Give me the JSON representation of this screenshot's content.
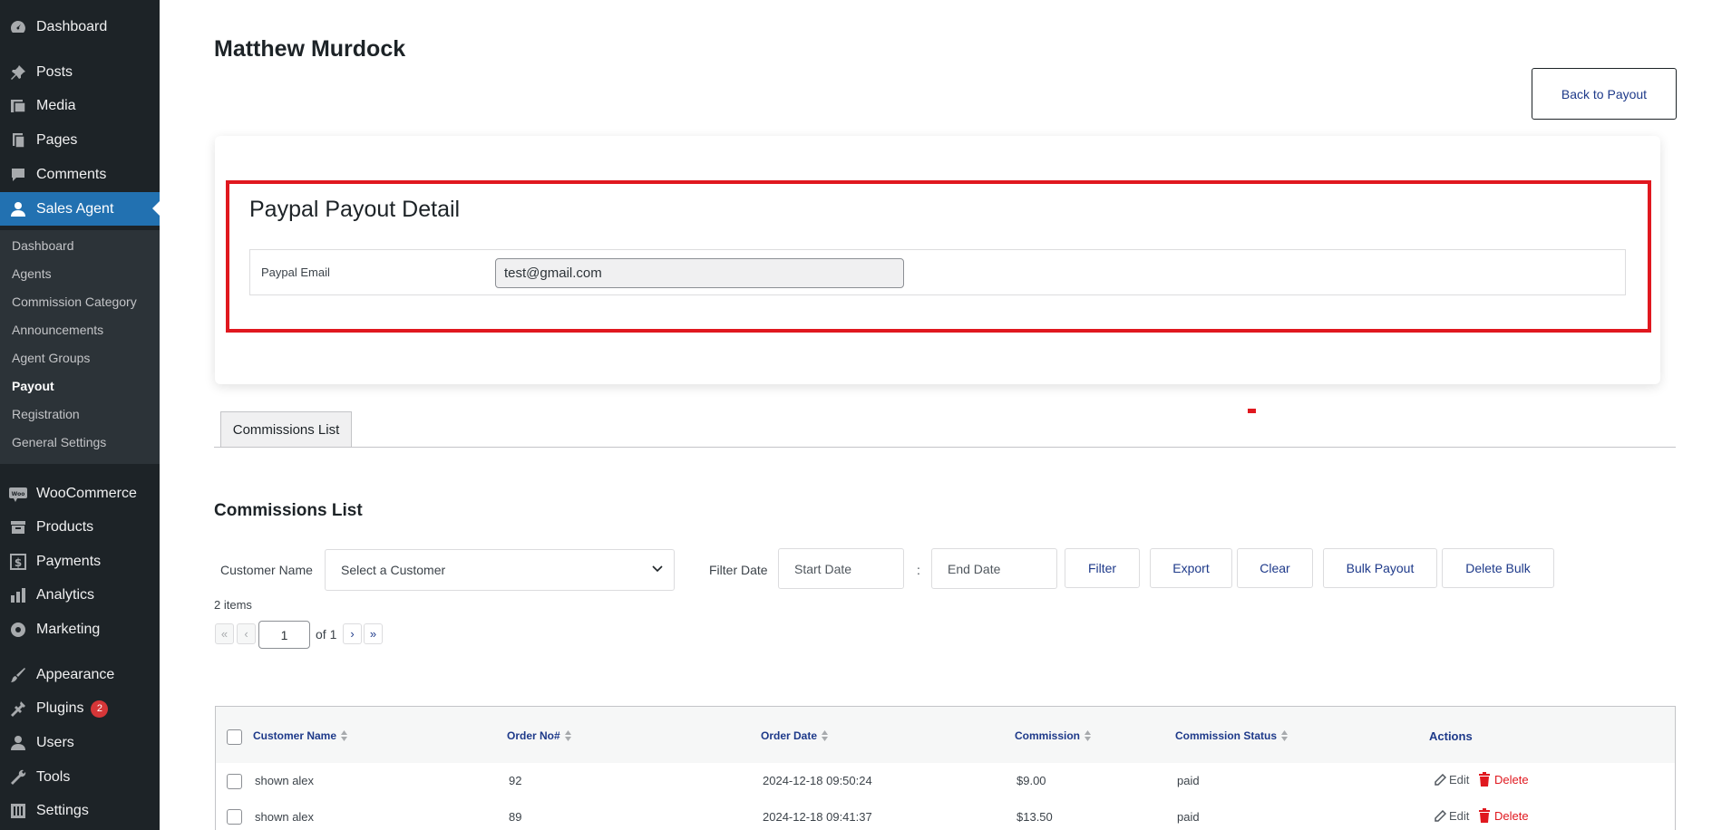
{
  "sidebar": {
    "menu": [
      {
        "label": "Dashboard",
        "icon": "dashboard-icon"
      },
      {
        "label": "Posts",
        "icon": "pin-icon"
      },
      {
        "label": "Media",
        "icon": "media-icon"
      },
      {
        "label": "Pages",
        "icon": "pages-icon"
      },
      {
        "label": "Comments",
        "icon": "comment-icon"
      },
      {
        "label": "Sales Agent",
        "icon": "user-icon"
      },
      {
        "label": "WooCommerce",
        "icon": "woo-icon"
      },
      {
        "label": "Products",
        "icon": "archive-icon"
      },
      {
        "label": "Payments",
        "icon": "dollar-icon"
      },
      {
        "label": "Analytics",
        "icon": "bar-chart-icon"
      },
      {
        "label": "Marketing",
        "icon": "megaphone-icon"
      },
      {
        "label": "Appearance",
        "icon": "brush-icon"
      },
      {
        "label": "Plugins",
        "icon": "plugin-icon",
        "badge": "2"
      },
      {
        "label": "Users",
        "icon": "users-icon"
      },
      {
        "label": "Tools",
        "icon": "wrench-icon"
      },
      {
        "label": "Settings",
        "icon": "settings-icon"
      }
    ],
    "submenu": [
      "Dashboard",
      "Agents",
      "Commission Category",
      "Announcements",
      "Agent Groups",
      "Payout",
      "Registration",
      "General Settings"
    ]
  },
  "page": {
    "title": "Matthew Murdock",
    "back_button": "Back to Payout"
  },
  "paypal": {
    "title": "Paypal Payout Detail",
    "email_label": "Paypal Email",
    "email_value": "test@gmail.com"
  },
  "tabs": {
    "commissions": "Commissions List"
  },
  "commissions": {
    "title": "Commissions List",
    "customer_label": "Customer Name",
    "customer_select": "Select a Customer",
    "filter_date_label": "Filter Date",
    "start_date_placeholder": "Start Date",
    "date_separator": ":",
    "end_date_placeholder": "End Date",
    "buttons": {
      "filter": "Filter",
      "export": "Export",
      "clear": "Clear",
      "bulk_payout": "Bulk Payout",
      "delete_bulk": "Delete Bulk"
    },
    "items_count": "2 items",
    "pagination": {
      "first": "«",
      "prev": "‹",
      "current": "1",
      "of": "of 1",
      "next": "›",
      "last": "»"
    }
  },
  "table": {
    "headers": [
      "Customer Name",
      "Order No#",
      "Order Date",
      "Commission",
      "Commission Status",
      "Actions"
    ],
    "rows": [
      {
        "customer": "shown alex",
        "order_no": "92",
        "date": "2024-12-18 09:50:24",
        "commission": "$9.00",
        "status": "paid"
      },
      {
        "customer": "shown alex",
        "order_no": "89",
        "date": "2024-12-18 09:41:37",
        "commission": "$13.50",
        "status": "paid"
      }
    ],
    "edit_label": "Edit",
    "delete_label": "Delete"
  },
  "colors": {
    "sidebar_bg": "#1d2327",
    "active_menu": "#2271b1",
    "highlight_frame": "#e0181f",
    "link_blue": "#1e3a8a",
    "delete_red": "#e0181f"
  }
}
